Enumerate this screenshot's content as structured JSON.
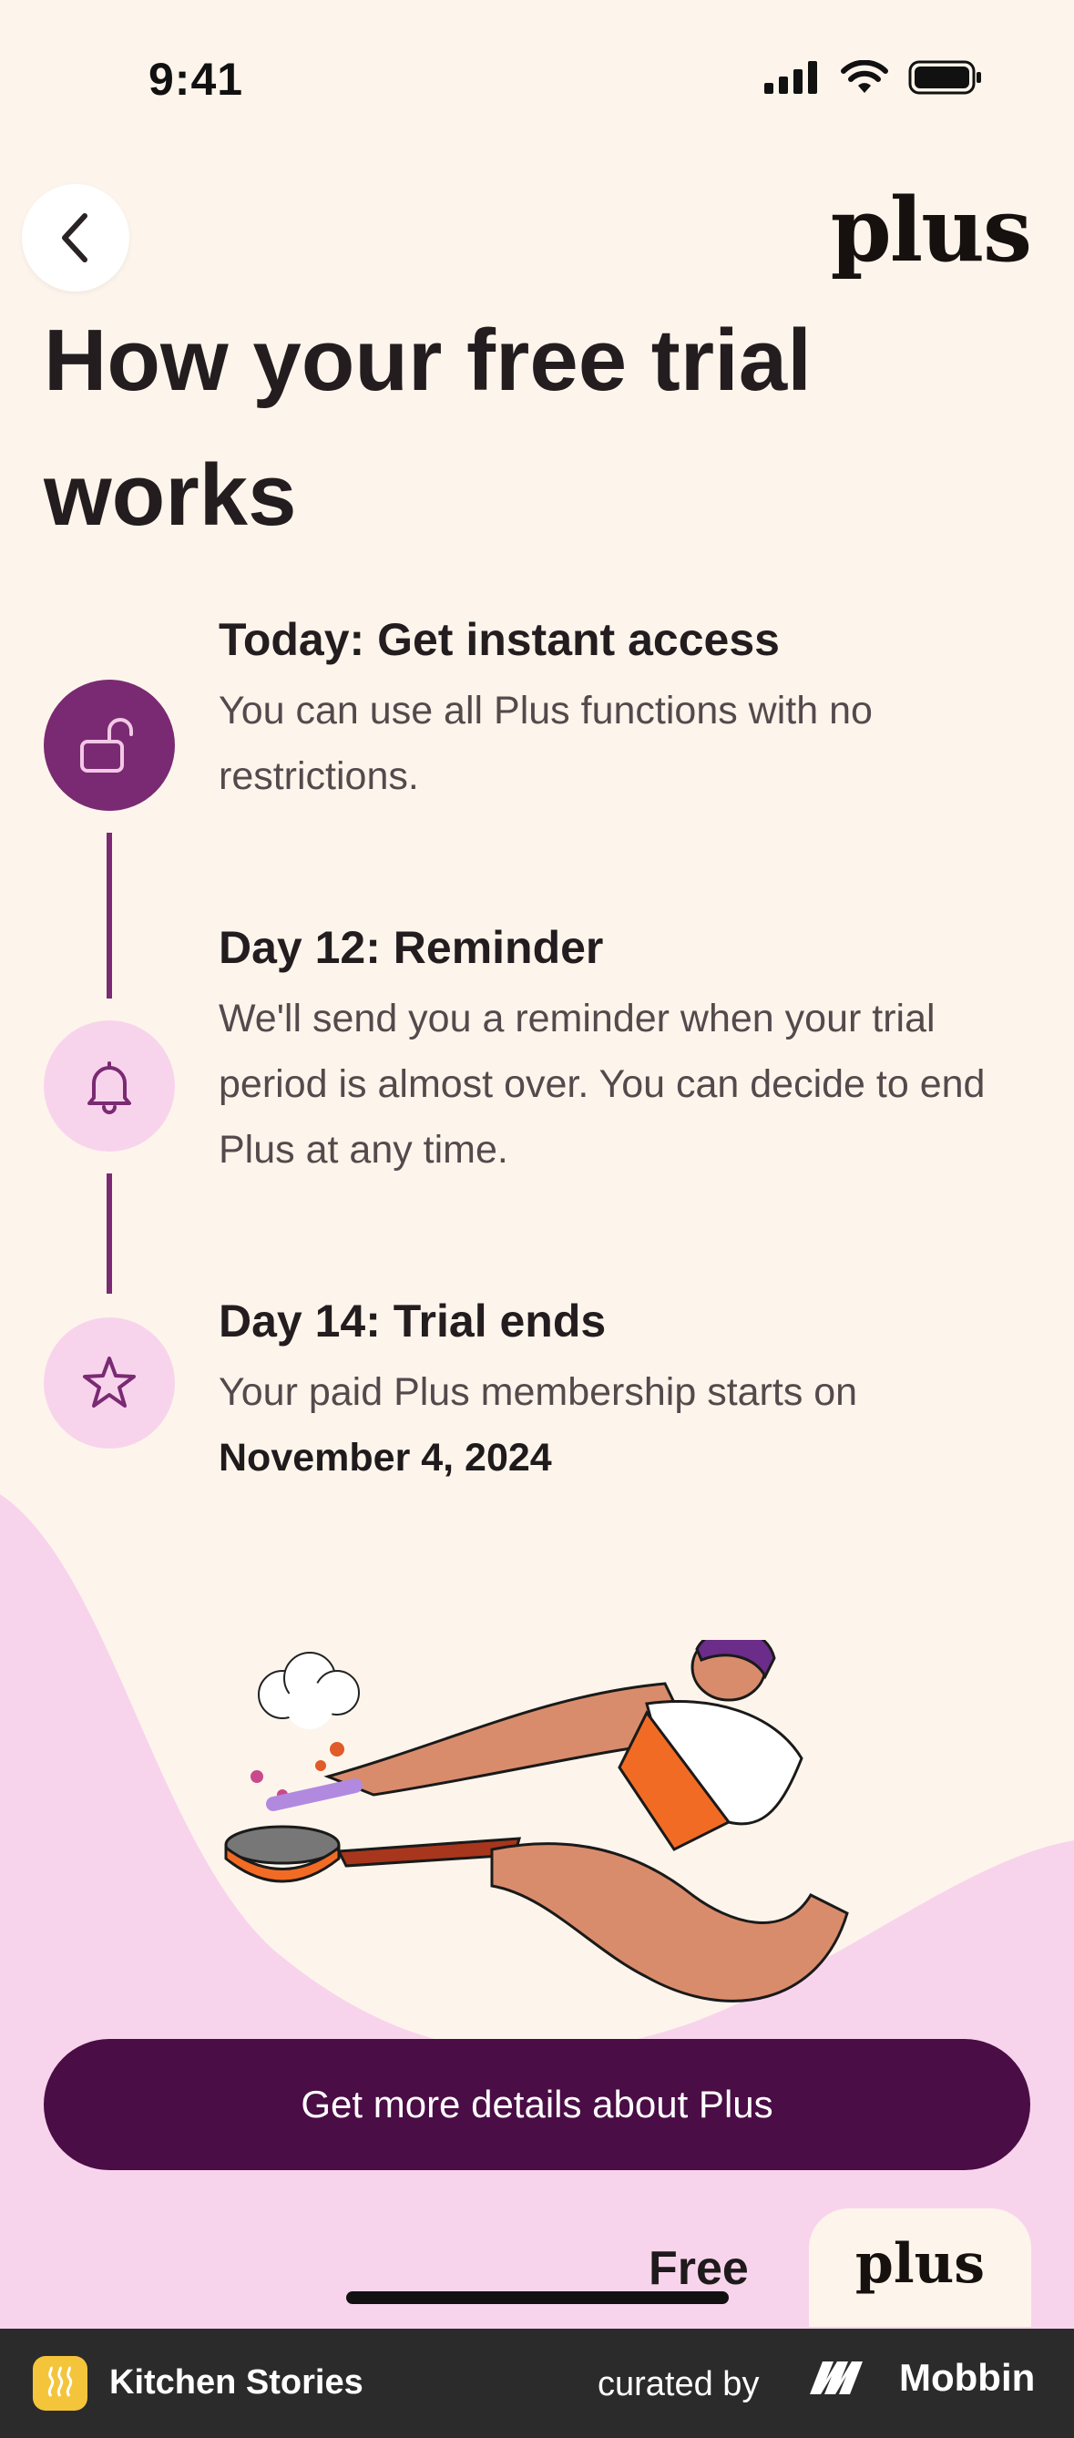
{
  "status_bar": {
    "time": "9:41"
  },
  "header": {
    "logo_text": "plus"
  },
  "page": {
    "title": "How your free trial works"
  },
  "steps": [
    {
      "title": "Today: Get instant access",
      "description": "You can use all Plus functions with no restrictions.",
      "icon": "unlock-icon"
    },
    {
      "title": "Day 12: Reminder",
      "description": "We'll send you a reminder when your trial period is almost over. You can decide to end Plus at any time.",
      "icon": "bell-icon"
    },
    {
      "title": "Day 14: Trial ends",
      "description": "Your paid Plus membership starts on",
      "date": "November 4, 2024",
      "icon": "star-icon"
    }
  ],
  "cta": {
    "label": "Get more details about Plus"
  },
  "tabs": {
    "free_label": "Free",
    "plus_label": "plus"
  },
  "footer": {
    "app_name": "Kitchen Stories",
    "curated_by": "curated by",
    "brand": "Mobbin"
  },
  "colors": {
    "background": "#fdf5ec",
    "accent_purple": "#7a2a72",
    "pink": "#f8d4ec",
    "cta": "#4a0d45"
  }
}
